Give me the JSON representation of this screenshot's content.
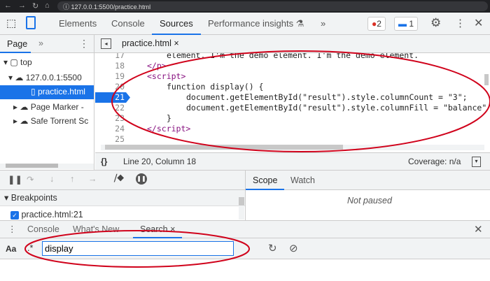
{
  "browser": {
    "url": "127.0.0.1:5500/practice.html"
  },
  "devtools": {
    "tabs": [
      "Elements",
      "Console",
      "Sources",
      "Performance insights"
    ],
    "active_tab": "Sources",
    "more": "»",
    "errors": "2",
    "messages": "1"
  },
  "navigator": {
    "tab": "Page",
    "more": "»",
    "tree": [
      "top",
      "127.0.0.1:5500",
      "practice.html",
      "Page Marker -",
      "Safe Torrent Sc"
    ]
  },
  "editor": {
    "file_tab": "practice.html",
    "lines": [
      {
        "n": "17",
        "text": "element. I'm the demo element. I'm the demo element."
      },
      {
        "n": "18",
        "text": "</p>"
      },
      {
        "n": "19",
        "text": "<script>"
      },
      {
        "n": "20",
        "text": "function display() {"
      },
      {
        "n": "21",
        "text": "document.getElementById(\"result\").style.columnCount = \"3\";"
      },
      {
        "n": "22",
        "text": "document.getElementById(\"result\").style.columnFill = \"balance\""
      },
      {
        "n": "23",
        "text": "}"
      },
      {
        "n": "24",
        "text": "</script>"
      },
      {
        "n": "25",
        "text": ""
      }
    ],
    "status_position": "Line 20, Column 18",
    "coverage": "Coverage: n/a"
  },
  "debugger": {
    "scope_tab": "Scope",
    "watch_tab": "Watch",
    "not_paused": "Not paused",
    "breakpoints_header": "Breakpoints",
    "breakpoint": "practice.html:21"
  },
  "drawer": {
    "tabs": [
      "Console",
      "What's New",
      "Search"
    ],
    "active": "Search",
    "case_label": "Aa",
    "regex_label": ".*",
    "search_value": "display"
  },
  "colors": {
    "accent": "#1a73e8",
    "annotation": "#d0021b"
  }
}
